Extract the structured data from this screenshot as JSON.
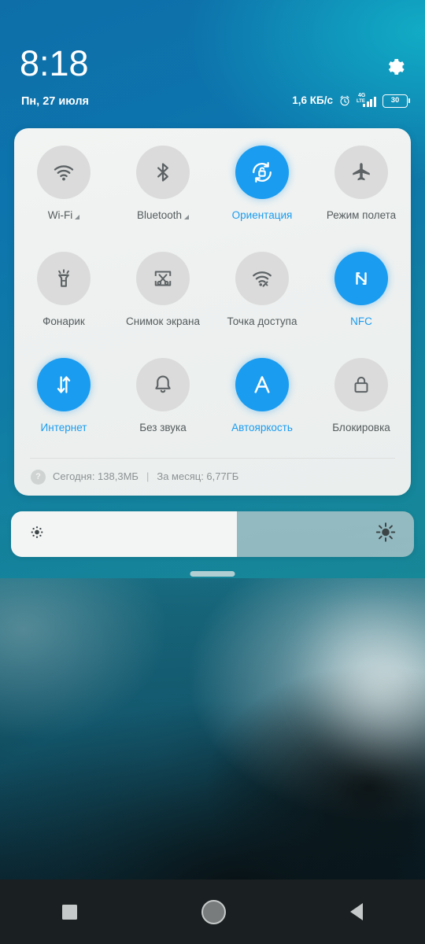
{
  "status_bar": {
    "time": "8:18",
    "date": "Пн, 27 июля",
    "network_speed": "1,6 КБ/с",
    "alarm_icon": "alarm-clock-icon",
    "signal_label": "4G",
    "signal_lte_label": "LTE",
    "battery_level": "30",
    "settings_icon": "gear-icon"
  },
  "quick_settings": {
    "rows": [
      [
        {
          "label": "Wi-Fi",
          "icon": "wifi-icon",
          "active": false,
          "expandable": true
        },
        {
          "label": "Bluetooth",
          "icon": "bluetooth-icon",
          "active": false,
          "expandable": true
        },
        {
          "label": "Ориентация",
          "icon": "rotation-lock-icon",
          "active": true,
          "expandable": false
        },
        {
          "label": "Режим полета",
          "icon": "airplane-icon",
          "active": false,
          "expandable": false
        }
      ],
      [
        {
          "label": "Фонарик",
          "icon": "flashlight-icon",
          "active": false,
          "expandable": false
        },
        {
          "label": "Снимок экрана",
          "icon": "screenshot-scissors-icon",
          "active": false,
          "expandable": false
        },
        {
          "label": "Точка доступа",
          "icon": "hotspot-icon",
          "active": false,
          "expandable": false
        },
        {
          "label": "NFC",
          "icon": "nfc-icon",
          "active": true,
          "expandable": false
        }
      ],
      [
        {
          "label": "Интернет",
          "icon": "data-arrows-icon",
          "active": true,
          "expandable": false
        },
        {
          "label": "Без звука",
          "icon": "bell-icon",
          "active": false,
          "expandable": false
        },
        {
          "label": "Автояркость",
          "icon": "auto-brightness-a-icon",
          "active": true,
          "expandable": false
        },
        {
          "label": "Блокировка",
          "icon": "lock-icon",
          "active": false,
          "expandable": false
        }
      ]
    ],
    "data_usage": {
      "badge": "?",
      "today": "Сегодня: 138,3МБ",
      "separator": "|",
      "month": "За месяц: 6,77ГБ"
    }
  },
  "brightness": {
    "value_percent": 56,
    "low_icon": "brightness-low-icon",
    "high_icon": "brightness-high-icon"
  },
  "nav_bar": {
    "recents_icon": "square-recents-icon",
    "home_icon": "circle-home-icon",
    "back_icon": "triangle-back-icon"
  },
  "colors": {
    "accent": "#1a9cf0",
    "panel_bg": "#f0f3f2",
    "tile_off": "#dbdbdb",
    "label": "#555b5d",
    "muted": "#8d9294"
  }
}
